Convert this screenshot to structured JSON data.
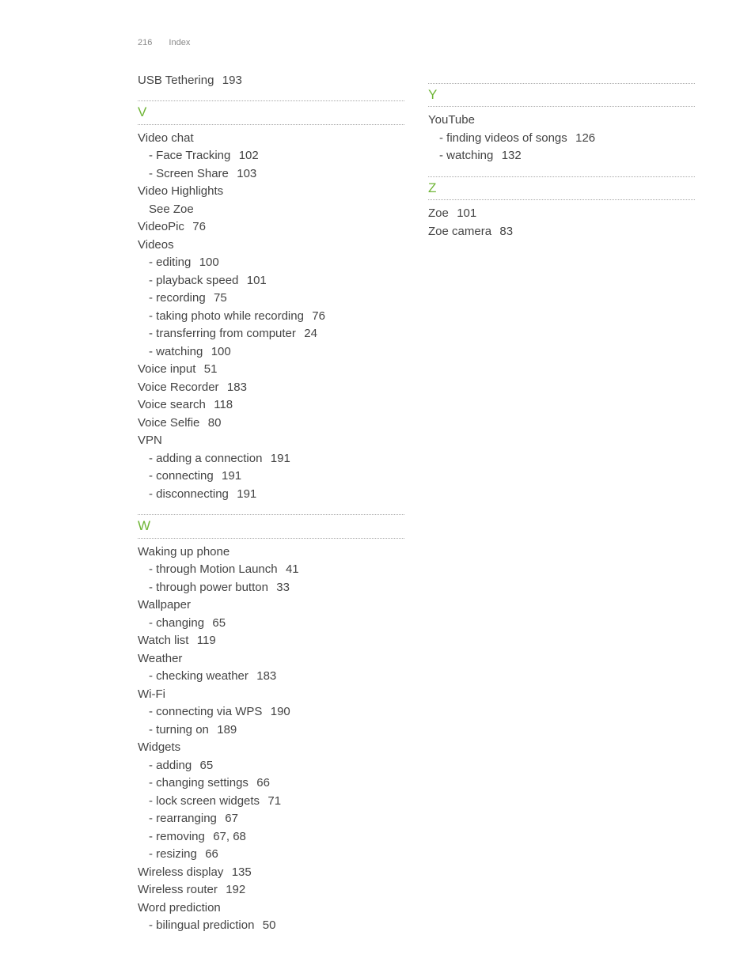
{
  "header": {
    "page_number": "216",
    "section": "Index"
  },
  "left": {
    "pre": [
      {
        "text": "USB Tethering",
        "pages": "193"
      }
    ],
    "sections": [
      {
        "letter": "V",
        "entries": [
          {
            "text": "Video chat",
            "pages": "",
            "subs": [
              {
                "text": "- Face Tracking",
                "pages": "102"
              },
              {
                "text": "- Screen Share",
                "pages": "103"
              }
            ]
          },
          {
            "text": "Video Highlights",
            "pages": "",
            "subs": [
              {
                "text": "See Zoe",
                "pages": ""
              }
            ]
          },
          {
            "text": "VideoPic",
            "pages": "76",
            "subs": []
          },
          {
            "text": "Videos",
            "pages": "",
            "subs": [
              {
                "text": "- editing",
                "pages": "100"
              },
              {
                "text": "- playback speed",
                "pages": "101"
              },
              {
                "text": "- recording",
                "pages": "75"
              },
              {
                "text": "- taking photo while recording",
                "pages": "76"
              },
              {
                "text": "- transferring from computer",
                "pages": "24"
              },
              {
                "text": "- watching",
                "pages": "100"
              }
            ]
          },
          {
            "text": "Voice input",
            "pages": "51",
            "subs": []
          },
          {
            "text": "Voice Recorder",
            "pages": "183",
            "subs": []
          },
          {
            "text": "Voice search",
            "pages": "118",
            "subs": []
          },
          {
            "text": "Voice Selfie",
            "pages": "80",
            "subs": []
          },
          {
            "text": "VPN",
            "pages": "",
            "subs": [
              {
                "text": "- adding a connection",
                "pages": "191"
              },
              {
                "text": "- connecting",
                "pages": "191"
              },
              {
                "text": "- disconnecting",
                "pages": "191"
              }
            ]
          }
        ]
      },
      {
        "letter": "W",
        "entries": [
          {
            "text": "Waking up phone",
            "pages": "",
            "subs": [
              {
                "text": "- through Motion Launch",
                "pages": "41"
              },
              {
                "text": "- through power button",
                "pages": "33"
              }
            ]
          },
          {
            "text": "Wallpaper",
            "pages": "",
            "subs": [
              {
                "text": "- changing",
                "pages": "65"
              }
            ]
          },
          {
            "text": "Watch list",
            "pages": "119",
            "subs": []
          },
          {
            "text": "Weather",
            "pages": "",
            "subs": [
              {
                "text": "- checking weather",
                "pages": "183"
              }
            ]
          },
          {
            "text": "Wi-Fi",
            "pages": "",
            "subs": [
              {
                "text": "- connecting via WPS",
                "pages": "190"
              },
              {
                "text": "- turning on",
                "pages": "189"
              }
            ]
          },
          {
            "text": "Widgets",
            "pages": "",
            "subs": [
              {
                "text": "- adding",
                "pages": "65"
              },
              {
                "text": "- changing settings",
                "pages": "66"
              },
              {
                "text": "- lock screen widgets",
                "pages": "71"
              },
              {
                "text": "- rearranging",
                "pages": "67"
              },
              {
                "text": "- removing",
                "pages": "67, 68"
              },
              {
                "text": "- resizing",
                "pages": "66"
              }
            ]
          },
          {
            "text": "Wireless display",
            "pages": "135",
            "subs": []
          },
          {
            "text": "Wireless router",
            "pages": "192",
            "subs": []
          },
          {
            "text": "Word prediction",
            "pages": "",
            "subs": [
              {
                "text": "- bilingual prediction",
                "pages": "50"
              }
            ]
          }
        ]
      }
    ]
  },
  "right": {
    "pre": [],
    "sections": [
      {
        "letter": "Y",
        "entries": [
          {
            "text": "YouTube",
            "pages": "",
            "subs": [
              {
                "text": "- finding videos of songs",
                "pages": "126"
              },
              {
                "text": "- watching",
                "pages": "132"
              }
            ]
          }
        ]
      },
      {
        "letter": "Z",
        "entries": [
          {
            "text": "Zoe",
            "pages": "101",
            "subs": []
          },
          {
            "text": "Zoe camera",
            "pages": "83",
            "subs": []
          }
        ]
      }
    ]
  }
}
